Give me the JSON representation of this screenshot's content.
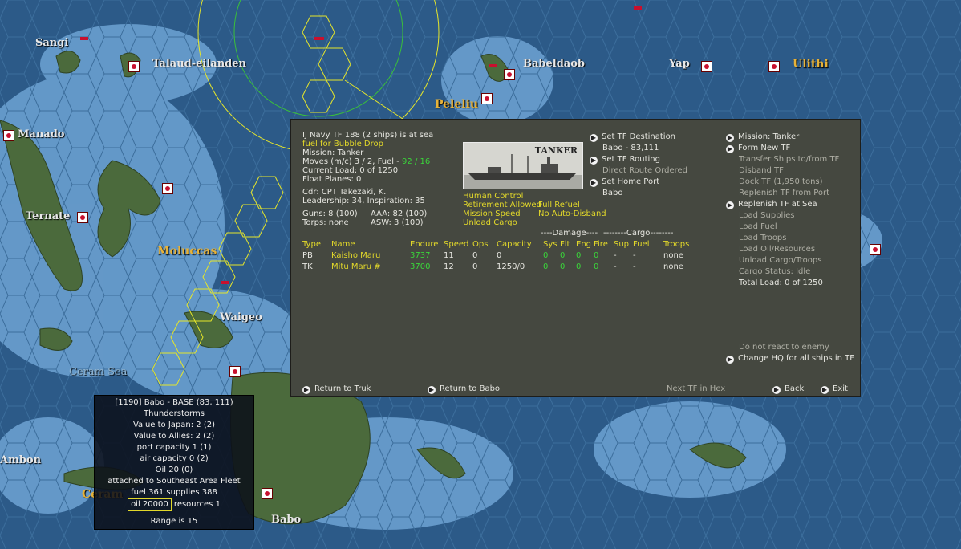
{
  "map": {
    "places": [
      {
        "id": "sangi",
        "label": "Sangi"
      },
      {
        "id": "talaud",
        "label": "Talaud-eilanden"
      },
      {
        "id": "babeldaob",
        "label": "Babeldaob"
      },
      {
        "id": "yap",
        "label": "Yap"
      },
      {
        "id": "ulithi",
        "label": "Ulithi"
      },
      {
        "id": "peleliu",
        "label": "Peleliu"
      },
      {
        "id": "manado",
        "label": "Manado"
      },
      {
        "id": "ternate",
        "label": "Ternate"
      },
      {
        "id": "moluccas",
        "label": "Moluccas"
      },
      {
        "id": "waigeo",
        "label": "Waigeo"
      },
      {
        "id": "ceram-sea",
        "label": "Ceram Sea"
      },
      {
        "id": "ambon",
        "label": "Ambon"
      },
      {
        "id": "ceram",
        "label": "Ceram"
      },
      {
        "id": "babo",
        "label": "Babo"
      }
    ]
  },
  "task_force": {
    "header": "IJ Navy TF 188 (2 ships) is at sea",
    "subheader": "fuel for Bubble Drop",
    "mission": "Mission: Tanker",
    "moves_prefix": "Moves (m/c) 3 / 2, Fuel - ",
    "moves_fuel": "92 / 16",
    "current_load": "Current Load: 0 of 1250",
    "float_planes": "Float Planes: 0",
    "commander": "Cdr: CPT Takezaki, K.",
    "leadership": "Leadership: 34, Inspiration: 35",
    "guns": "Guns: 8 (100)",
    "aaa": "AAA: 82 (100)",
    "torps": "Torps: none",
    "asw": "ASW: 3 (100)",
    "photo_label": "TANKER",
    "control": {
      "human_control": "Human Control",
      "retirement": "Retirement Allowed",
      "refuel": "Full Refuel",
      "mission_speed": "Mission Speed",
      "disband": "No Auto-Disband",
      "unload": "Unload Cargo"
    },
    "destination": {
      "set_dest": "Set TF Destination",
      "dest_value": "Babo - 83,111",
      "set_routing": "Set TF Routing",
      "routing_value": "Direct Route Ordered",
      "set_home": "Set Home Port",
      "home_value": "Babo"
    },
    "table": {
      "damage_header": "----Damage----",
      "cargo_header": "--------Cargo--------",
      "columns": [
        "Type",
        "Name",
        "Endure",
        "Speed",
        "Ops",
        "Capacity",
        "Sys",
        "Flt",
        "Eng",
        "Fire",
        "Sup",
        "Fuel",
        "Troops"
      ],
      "rows": [
        {
          "type": "PB",
          "name": "Kaisho Maru",
          "endure": "3737",
          "speed": "11",
          "ops": "0",
          "capacity": "0",
          "sys": "0",
          "flt": "0",
          "eng": "0",
          "fire": "0",
          "sup": "-",
          "fuel": "-",
          "troops": "none"
        },
        {
          "type": "TK",
          "name": "Mitu Maru #",
          "endure": "3700",
          "speed": "12",
          "ops": "0",
          "capacity": "1250/0",
          "sys": "0",
          "flt": "0",
          "eng": "0",
          "fire": "0",
          "sup": "-",
          "fuel": "-",
          "troops": "none"
        }
      ]
    },
    "menu": {
      "mission": "Mission: Tanker",
      "form_new": "Form New TF",
      "transfer": "Transfer Ships to/from TF",
      "disband": "Disband TF",
      "dock": "Dock TF (1,950 tons)",
      "replenish_port": "Replenish TF from Port",
      "replenish_sea": "Replenish TF at Sea",
      "load_supplies": "Load Supplies",
      "load_fuel": "Load Fuel",
      "load_troops": "Load Troops",
      "load_oil": "Load Oil/Resources",
      "unload_cargo": "Unload Cargo/Troops",
      "cargo_status": "Cargo Status: Idle",
      "total_load": "Total Load: 0 of 1250",
      "no_react": "Do not react to enemy",
      "change_hq": "Change HQ for all ships in TF"
    },
    "footer": {
      "return_truk": "Return to Truk",
      "return_babo": "Return to Babo",
      "next_tf": "Next TF in Hex",
      "back": "Back",
      "exit": "Exit"
    }
  },
  "base_info": {
    "title": "[1190] Babo - BASE (83, 111)",
    "weather": "Thunderstorms",
    "value_japan": "Value to Japan: 2 (2)",
    "value_allies": "Value to Allies: 2 (2)",
    "port_capacity": "port capacity 1 (1)",
    "air_capacity": "air capacity 0 (2)",
    "oil": "Oil 20 (0)",
    "attached": "attached to Southeast Area Fleet",
    "fuel_supplies": "fuel 361 supplies 388",
    "oil_value": "oil 20000",
    "resources": "resources 1",
    "range": "Range is 15"
  }
}
